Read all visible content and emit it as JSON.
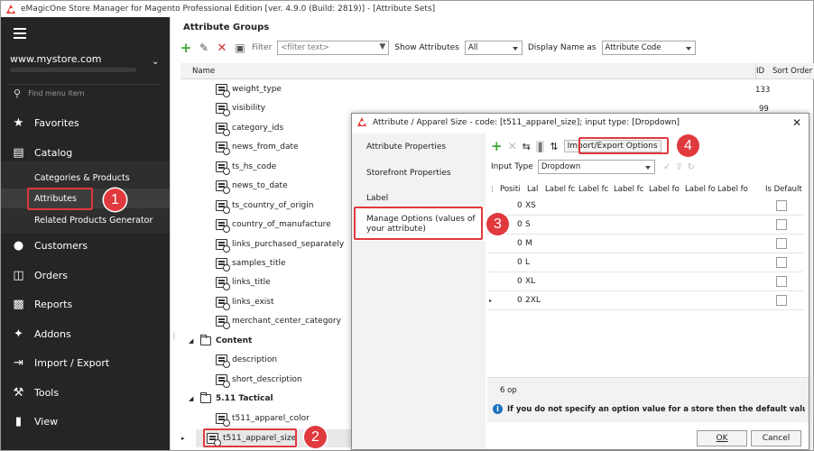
{
  "window": {
    "title": "eMagicOne Store Manager for Magento Professional Edition [ver. 4.9.0 (Build: 2819)] - [Attribute Sets]"
  },
  "sidebar": {
    "store": "www.mystore.com",
    "search_placeholder": "Find menu item",
    "items": [
      {
        "label": "Favorites",
        "icon": "star-icon"
      },
      {
        "label": "Catalog",
        "icon": "catalog-icon"
      },
      {
        "label": "Customers",
        "icon": "customers-icon"
      },
      {
        "label": "Orders",
        "icon": "orders-icon"
      },
      {
        "label": "Reports",
        "icon": "reports-icon"
      },
      {
        "label": "Addons",
        "icon": "puzzle-icon"
      },
      {
        "label": "Import / Export",
        "icon": "import-export-icon"
      },
      {
        "label": "Tools",
        "icon": "wrench-icon"
      },
      {
        "label": "View",
        "icon": "view-icon"
      }
    ],
    "catalog_sub": [
      {
        "label": "Categories & Products"
      },
      {
        "label": "Attributes"
      },
      {
        "label": "Related Products Generator"
      }
    ]
  },
  "main": {
    "title": "Attribute Groups",
    "toolbar": {
      "filter_label": "Filter",
      "filter_placeholder": "<filter text>",
      "show_label": "Show Attributes",
      "show_value": "All",
      "display_label": "Display Name as",
      "display_value": "Attribute Code"
    },
    "columns": {
      "name": "Name",
      "id": "ID",
      "sort": "Sort Order"
    },
    "tree": [
      {
        "label": "weight_type",
        "type": "attr",
        "id": "133"
      },
      {
        "label": "visibility",
        "type": "attr",
        "id": "99"
      },
      {
        "label": "category_ids",
        "type": "attr",
        "id": ""
      },
      {
        "label": "news_from_date",
        "type": "attr",
        "id": ""
      },
      {
        "label": "ts_hs_code",
        "type": "attr",
        "id": ""
      },
      {
        "label": "news_to_date",
        "type": "attr",
        "id": ""
      },
      {
        "label": "ts_country_of_origin",
        "type": "attr",
        "id": ""
      },
      {
        "label": "country_of_manufacture",
        "type": "attr",
        "id": ""
      },
      {
        "label": "links_purchased_separately",
        "type": "attr",
        "id": ""
      },
      {
        "label": "samples_title",
        "type": "attr",
        "id": ""
      },
      {
        "label": "links_title",
        "type": "attr",
        "id": ""
      },
      {
        "label": "links_exist",
        "type": "attr",
        "id": ""
      },
      {
        "label": "merchant_center_category",
        "type": "attr",
        "id": ""
      },
      {
        "label": "Content",
        "type": "folder",
        "id": ""
      },
      {
        "label": "description",
        "type": "attr",
        "id": ""
      },
      {
        "label": "short_description",
        "type": "attr",
        "id": ""
      },
      {
        "label": "5.11 Tactical",
        "type": "folder",
        "id": ""
      },
      {
        "label": "t511_apparel_color",
        "type": "attr",
        "id": ""
      },
      {
        "label": "t511_apparel_size",
        "type": "attr",
        "id": ""
      }
    ]
  },
  "dialog": {
    "title": "Attribute / Apparel Size - code: [t511_apparel_size]; input type: [Dropdown]",
    "nav": [
      "Attribute Properties",
      "Storefront Properties",
      "Label",
      "Manage Options (values of your attribute)"
    ],
    "import_export": "Import/Export Options",
    "input_type_label": "Input Type",
    "input_type_value": "Dropdown",
    "columns": [
      "Positi",
      "Lal",
      "Label fc",
      "Label fc",
      "Label fc",
      "Label fo",
      "Label fo",
      "Label fo",
      "Is Default"
    ],
    "options": [
      {
        "pos": "0",
        "label": "XS"
      },
      {
        "pos": "0",
        "label": "S"
      },
      {
        "pos": "0",
        "label": "M"
      },
      {
        "pos": "0",
        "label": "L"
      },
      {
        "pos": "0",
        "label": "XL"
      },
      {
        "pos": "0",
        "label": "2XL"
      }
    ],
    "count": "6 op",
    "info": "If you do not specify an option value for a store then the default value will be",
    "ok": "OK",
    "cancel": "Cancel"
  },
  "callouts": [
    "1",
    "2",
    "3",
    "4"
  ],
  "colors": {
    "accent": "#e0393e",
    "sidebar_bg": "#252525",
    "add_green": "#3aa935"
  }
}
